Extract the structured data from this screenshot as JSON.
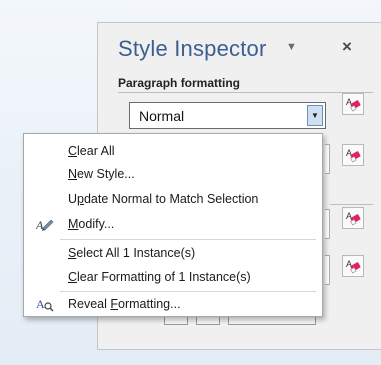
{
  "panel": {
    "title": "Style Inspector",
    "chevron_glyph": "▼",
    "close_glyph": "×",
    "section_label": "Paragraph formatting",
    "style_combo": {
      "value": "Normal",
      "arrow_glyph": "▼"
    },
    "icons": {
      "clear_format": "eraser-icon",
      "menu_chevron": "chevron-down-icon",
      "close": "close-icon",
      "modify": "modify-style-icon",
      "reveal": "reveal-formatting-icon"
    }
  },
  "context_menu": {
    "items": [
      {
        "pre": "",
        "key": "C",
        "post": "lear All"
      },
      {
        "pre": "",
        "key": "N",
        "post": "ew Style..."
      },
      {
        "pre": "U",
        "key": "p",
        "post": "date Normal to Match Selection"
      },
      {
        "pre": "",
        "key": "M",
        "post": "odify..."
      },
      {
        "pre": "",
        "key": "S",
        "post": "elect All 1 Instance(s)"
      },
      {
        "pre": "",
        "key": "C",
        "post": "lear Formatting of 1 Instance(s)"
      },
      {
        "pre": "Reveal ",
        "key": "F",
        "post": "ormatting..."
      }
    ]
  }
}
